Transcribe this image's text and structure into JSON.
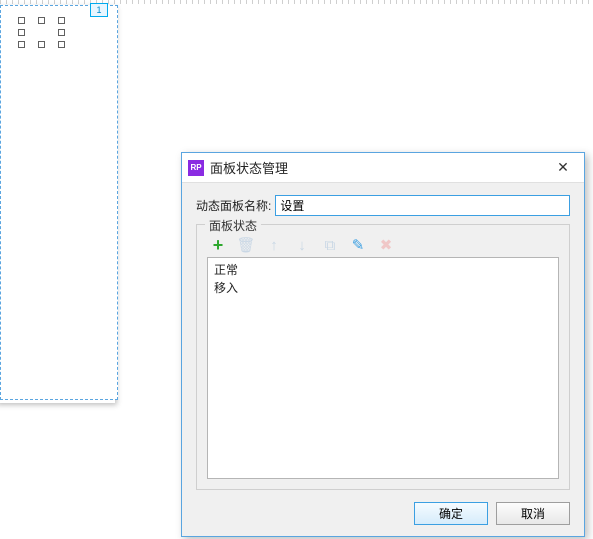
{
  "appIconText": "RP",
  "dialog": {
    "title": "面板状态管理",
    "close": "✕",
    "nameLabel": "动态面板名称:",
    "nameValue": "设置",
    "fieldsetTitle": "面板状态",
    "states": [
      "正常",
      "移入"
    ],
    "okLabel": "确定",
    "cancelLabel": "取消"
  },
  "toolbar": {
    "add": {
      "glyph": "+",
      "color": "#2ea82e",
      "enabled": true
    },
    "delete": {
      "glyph": "🗑",
      "color": "#c9d7e5",
      "enabled": false
    },
    "moveUp": {
      "glyph": "↑",
      "color": "#c9d7e5",
      "enabled": false
    },
    "moveDown": {
      "glyph": "↓",
      "color": "#c9d7e5",
      "enabled": false
    },
    "copy": {
      "glyph": "⧉",
      "color": "#c9d7e5",
      "enabled": false
    },
    "edit": {
      "glyph": "✎",
      "color": "#3b9fe2",
      "enabled": true
    },
    "remove": {
      "glyph": "✖",
      "color": "#f0c7c7",
      "enabled": false
    }
  },
  "tabHandle": "1"
}
